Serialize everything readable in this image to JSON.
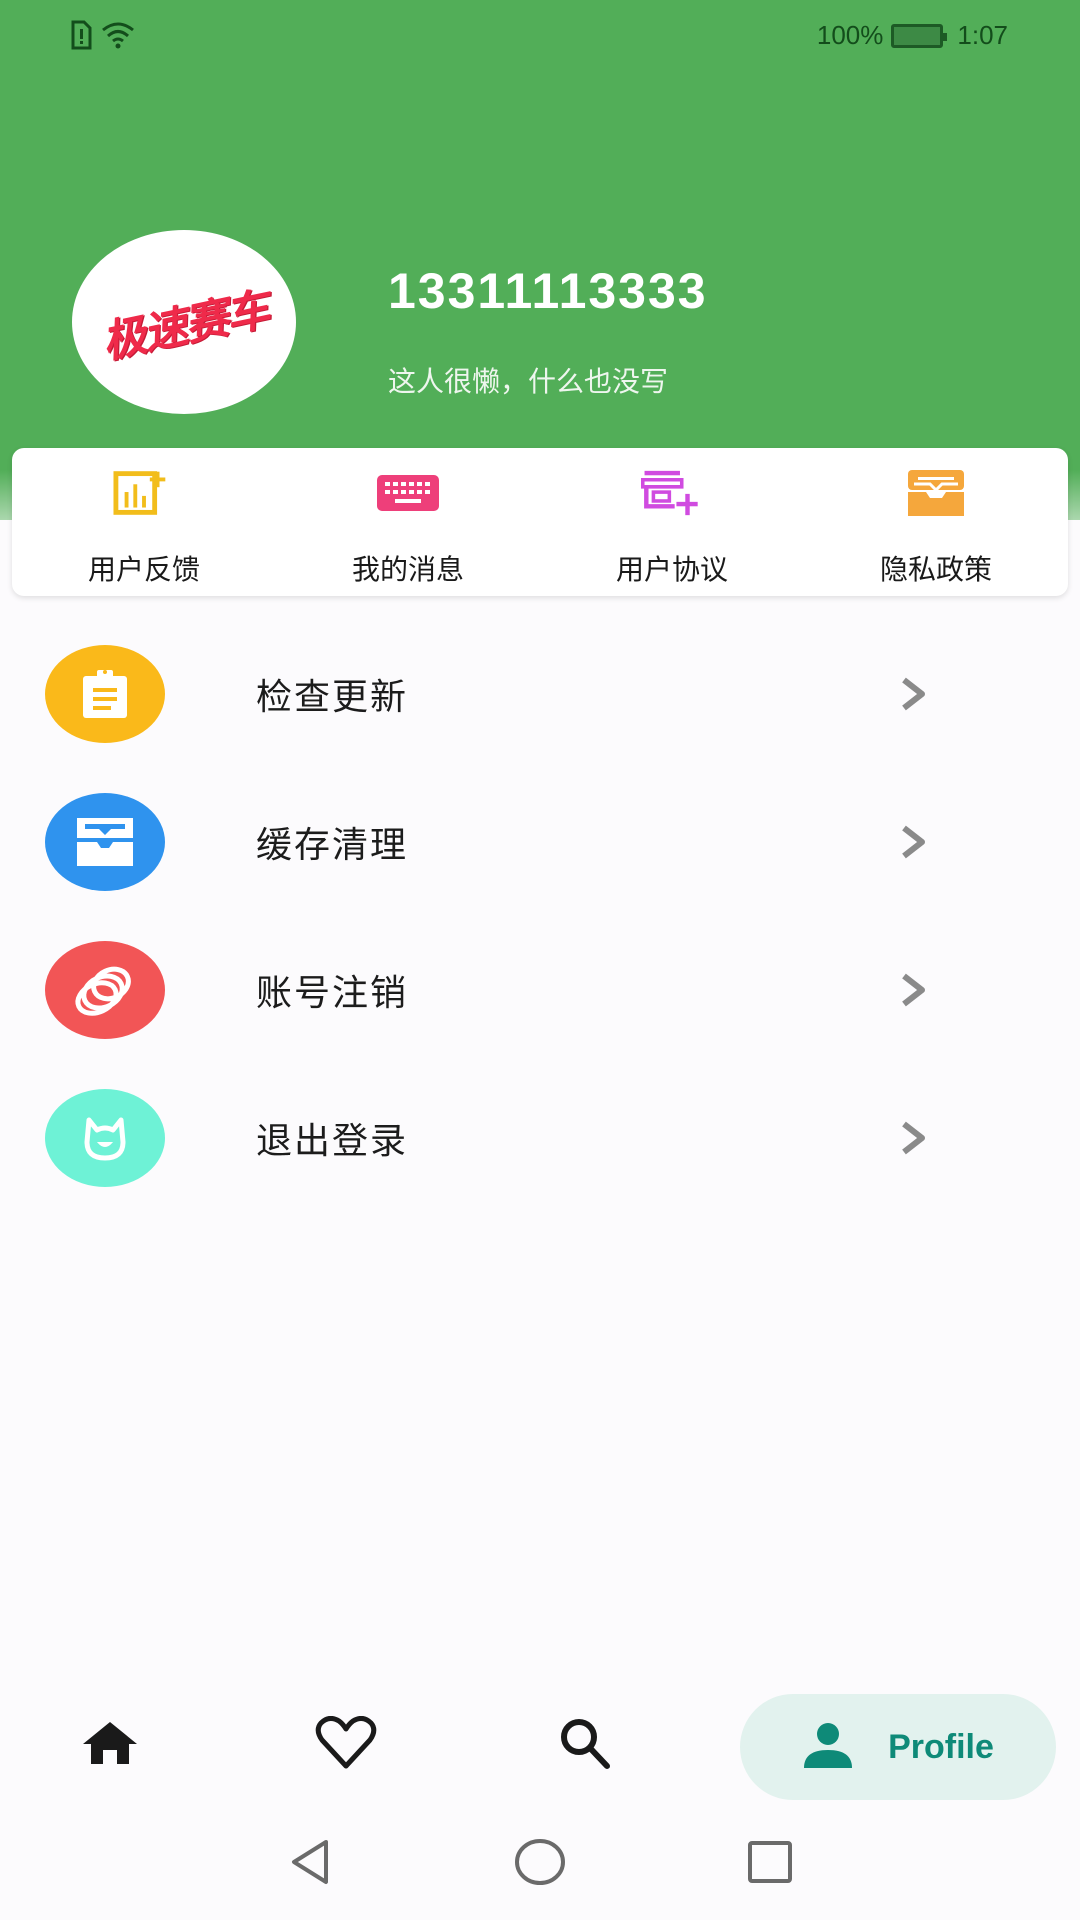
{
  "status_bar": {
    "battery_percent": "100%",
    "time": "1:07",
    "icons": [
      "sim-alert-icon",
      "wifi-icon",
      "battery-charging-icon"
    ]
  },
  "profile": {
    "avatar_text": "极速赛车",
    "phone": "13311113333",
    "bio": "这人很懒，什么也没写"
  },
  "quick_actions": [
    {
      "label": "用户反馈",
      "icon": "feedback-chart-icon",
      "color": "#f2bd1b"
    },
    {
      "label": "我的消息",
      "icon": "keyboard-icon",
      "color": "#ee3f7a"
    },
    {
      "label": "用户协议",
      "icon": "store-add-icon",
      "color": "#d04be0"
    },
    {
      "label": "隐私政策",
      "icon": "inbox-icon",
      "color": "#f5a73c"
    }
  ],
  "menu": [
    {
      "label": "检查更新",
      "icon": "clipboard-icon",
      "color": "#fab91a"
    },
    {
      "label": "缓存清理",
      "icon": "archive-icon",
      "color": "#2f93ee"
    },
    {
      "label": "账号注销",
      "icon": "rings-icon",
      "color": "#f25556"
    },
    {
      "label": "退出登录",
      "icon": "cat-face-icon",
      "color": "#6ef2d6"
    }
  ],
  "bottom_nav": {
    "items": [
      {
        "name": "home",
        "icon": "home-icon"
      },
      {
        "name": "favorites",
        "icon": "heart-icon"
      },
      {
        "name": "search",
        "icon": "search-icon"
      }
    ],
    "active": {
      "label": "Profile",
      "icon": "person-icon",
      "color": "#0e8a78"
    }
  }
}
